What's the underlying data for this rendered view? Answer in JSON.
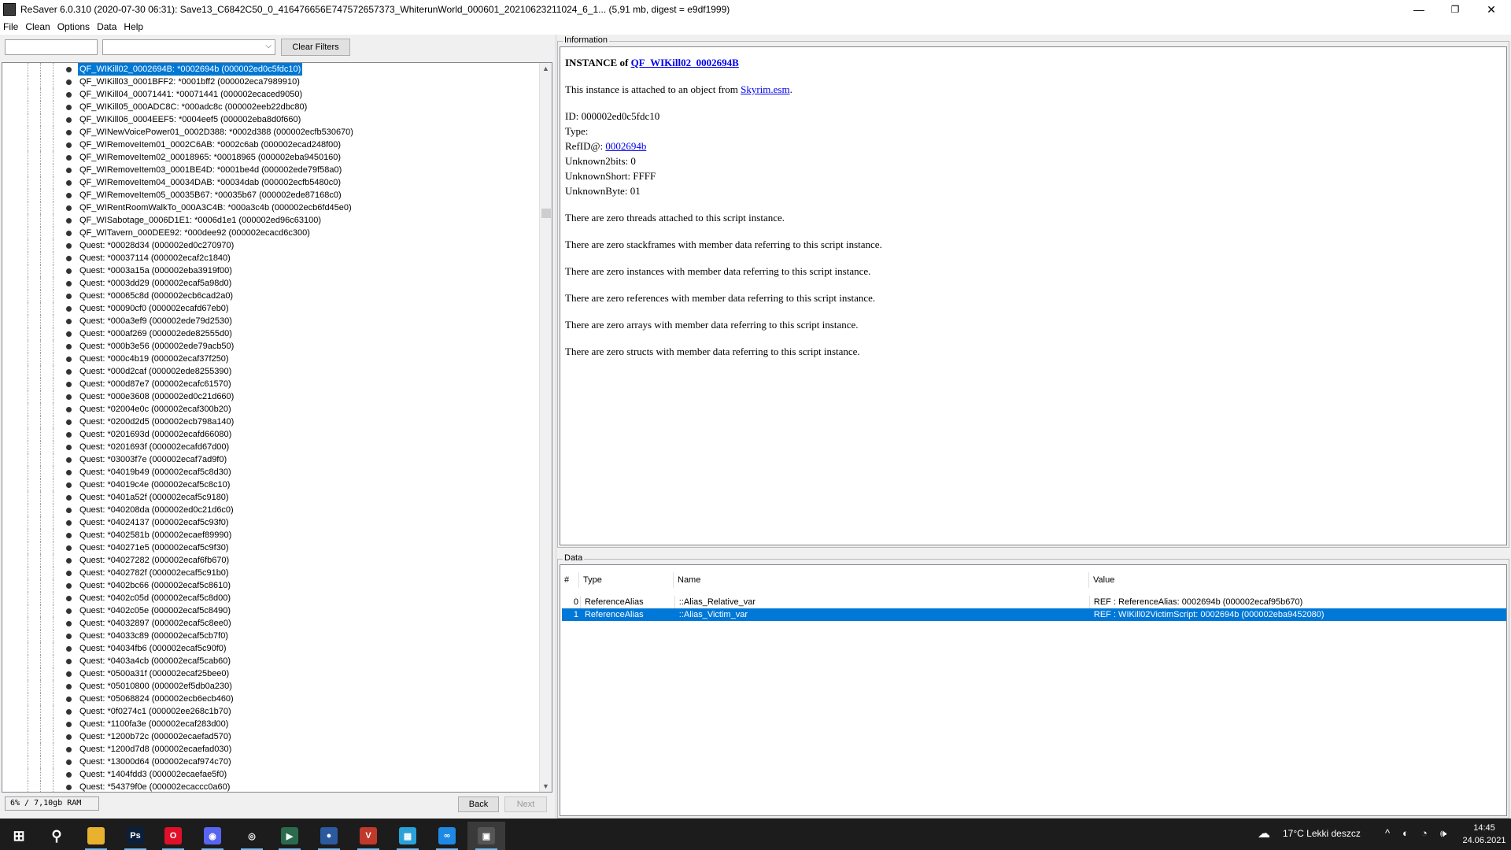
{
  "window": {
    "title": "ReSaver 6.0.310 (2020-07-30 06:31): Save13_C6842C50_0_416476656E747572657373_WhiterunWorld_000601_20210623211024_6_1... (5,91 mb, digest = e9df1999)",
    "minimize": "—",
    "maximize": "❐",
    "close": "✕"
  },
  "menu": [
    "File",
    "Clean",
    "Options",
    "Data",
    "Help"
  ],
  "filters": {
    "text_value": "",
    "combo_value": "",
    "clear_label": "Clear Filters"
  },
  "tree_items": [
    "QF_WIKill02_0002694B: *0002694b (000002ed0c5fdc10)",
    "QF_WIKill03_0001BFF2: *0001bff2 (000002eca7989910)",
    "QF_WIKill04_00071441: *00071441 (000002ecaced9050)",
    "QF_WIKill05_000ADC8C: *000adc8c (000002eeb22dbc80)",
    "QF_WIKill06_0004EEF5: *0004eef5 (000002eba8d0f660)",
    "QF_WINewVoicePower01_0002D388: *0002d388 (000002ecfb530670)",
    "QF_WIRemoveItem01_0002C6AB: *0002c6ab (000002ecad248f00)",
    "QF_WIRemoveItem02_00018965: *00018965 (000002eba9450160)",
    "QF_WIRemoveItem03_0001BE4D: *0001be4d (000002ede79f58a0)",
    "QF_WIRemoveItem04_00034DAB: *00034dab (000002ecfb5480c0)",
    "QF_WIRemoveItem05_00035B67: *00035b67 (000002ede87168c0)",
    "QF_WIRentRoomWalkTo_000A3C4B: *000a3c4b (000002ecb6fd45e0)",
    "QF_WISabotage_0006D1E1: *0006d1e1 (000002ed96c63100)",
    "QF_WITavern_000DEE92: *000dee92 (000002ecacd6c300)",
    "Quest: *00028d34 (000002ed0c270970)",
    "Quest: *00037114 (000002ecaf2c1840)",
    "Quest: *0003a15a (000002eba3919f00)",
    "Quest: *0003dd29 (000002ecaf5a98d0)",
    "Quest: *00065c8d (000002ecb6cad2a0)",
    "Quest: *00090cf0 (000002ecafd67eb0)",
    "Quest: *000a3ef9 (000002ede79d2530)",
    "Quest: *000af269 (000002ede82555d0)",
    "Quest: *000b3e56 (000002ede79acb50)",
    "Quest: *000c4b19 (000002ecaf37f250)",
    "Quest: *000d2caf (000002ede8255390)",
    "Quest: *000d87e7 (000002ecafc61570)",
    "Quest: *000e3608 (000002ed0c21d660)",
    "Quest: *02004e0c (000002ecaf300b20)",
    "Quest: *0200d2d5 (000002ecb798a140)",
    "Quest: *0201693d (000002ecafd66080)",
    "Quest: *0201693f (000002ecafd67d00)",
    "Quest: *03003f7e (000002ecaf7ad9f0)",
    "Quest: *04019b49 (000002ecaf5c8d30)",
    "Quest: *04019c4e (000002ecaf5c8c10)",
    "Quest: *0401a52f (000002ecaf5c9180)",
    "Quest: *040208da (000002ed0c21d6c0)",
    "Quest: *04024137 (000002ecaf5c93f0)",
    "Quest: *0402581b (000002ecaef89990)",
    "Quest: *040271e5 (000002ecaf5c9f30)",
    "Quest: *04027282 (000002ecaf6fb670)",
    "Quest: *0402782f (000002ecaf5c91b0)",
    "Quest: *0402bc66 (000002ecaf5c8610)",
    "Quest: *0402c05d (000002ecaf5c8d00)",
    "Quest: *0402c05e (000002ecaf5c8490)",
    "Quest: *04032897 (000002ecaf5c8ee0)",
    "Quest: *04033c89 (000002ecaf5cb7f0)",
    "Quest: *04034fb6 (000002ecaf5c90f0)",
    "Quest: *0403a4cb (000002ecaf5cab60)",
    "Quest: *0500a31f (000002ecaf25bee0)",
    "Quest: *05010800 (000002ef5db0a230)",
    "Quest: *05068824 (000002ecb6ecb460)",
    "Quest: *0f0274c1 (000002ee268c1b70)",
    "Quest: *1100fa3e (000002ecaf283d00)",
    "Quest: *1200b72c (000002ecaefad570)",
    "Quest: *1200d7d8 (000002ecaefad030)",
    "Quest: *13000d64 (000002ecaf974c70)",
    "Quest: *1404fdd3 (000002ecaefae5f0)",
    "Quest: *54379f0e (000002ecaccc0a60)"
  ],
  "tree_selected_index": 0,
  "status_ram": "6% / 7,10gb RAM",
  "nav": {
    "back": "Back",
    "next": "Next"
  },
  "info": {
    "legend": "Information",
    "heading_prefix": "INSTANCE of ",
    "heading_link": "QF_WIKill02_0002694B",
    "attached_prefix": "This instance is attached to an object from ",
    "attached_link": "Skyrim.esm",
    "attached_suffix": ".",
    "id_line": "ID: 000002ed0c5fdc10",
    "type_line": "Type:",
    "refid_prefix": "RefID@: ",
    "refid_link": "0002694b",
    "unknown2bits": "Unknown2bits: 0",
    "unknownshort": "UnknownShort: FFFF",
    "unknownbyte": "UnknownByte: 01",
    "threads": "There are zero threads attached to this script instance.",
    "stackframes": "There are zero stackframes with member data referring to this script instance.",
    "instances": "There are zero instances with member data referring to this script instance.",
    "references": "There are zero references with member data referring to this script instance.",
    "arrays": "There are zero arrays with member data referring to this script instance.",
    "structs": "There are zero structs with member data referring to this script instance."
  },
  "data": {
    "legend": "Data",
    "headers": {
      "num": "#",
      "type": "Type",
      "name": "Name",
      "value": "Value"
    },
    "rows": [
      {
        "num": "0",
        "type": "ReferenceAlias",
        "name": "::Alias_Relative_var",
        "value": "REF : ReferenceAlias: 0002694b (000002ecaf95b670)"
      },
      {
        "num": "1",
        "type": "ReferenceAlias",
        "name": "::Alias_Victim_var",
        "value": "REF : WIKill02VictimScript: 0002694b (000002eba9452080)"
      }
    ],
    "selected_row": 1
  },
  "taskbar": {
    "weather": "17°C  Lekki deszcz",
    "time": "14:45",
    "date": "24.06.2021",
    "apps": [
      {
        "name": "start-icon",
        "color": "#1c1c1c",
        "glyph": "⊞"
      },
      {
        "name": "search-icon",
        "color": "#1c1c1c",
        "glyph": "⚲"
      },
      {
        "name": "file-explorer-icon",
        "color": "#e8b22e",
        "glyph": ""
      },
      {
        "name": "photoshop-icon",
        "color": "#0b1f3a",
        "glyph": "Ps"
      },
      {
        "name": "opera-icon",
        "color": "#e0102a",
        "glyph": "O"
      },
      {
        "name": "discord-icon",
        "color": "#5865f2",
        "glyph": "◉"
      },
      {
        "name": "steam-icon",
        "color": "#1c1c1c",
        "glyph": "◎"
      },
      {
        "name": "app-green-icon",
        "color": "#2b6b4d",
        "glyph": "▶"
      },
      {
        "name": "app-blue-circle-icon",
        "color": "#2c5aa0",
        "glyph": "●"
      },
      {
        "name": "voicemeeter-icon",
        "color": "#c0392b",
        "glyph": "V"
      },
      {
        "name": "mod-organizer-icon",
        "color": "#2aa1d8",
        "glyph": "▦"
      },
      {
        "name": "app-link-icon",
        "color": "#1e88e5",
        "glyph": "∞"
      },
      {
        "name": "resaver-icon",
        "color": "#555555",
        "glyph": "▣"
      }
    ]
  }
}
